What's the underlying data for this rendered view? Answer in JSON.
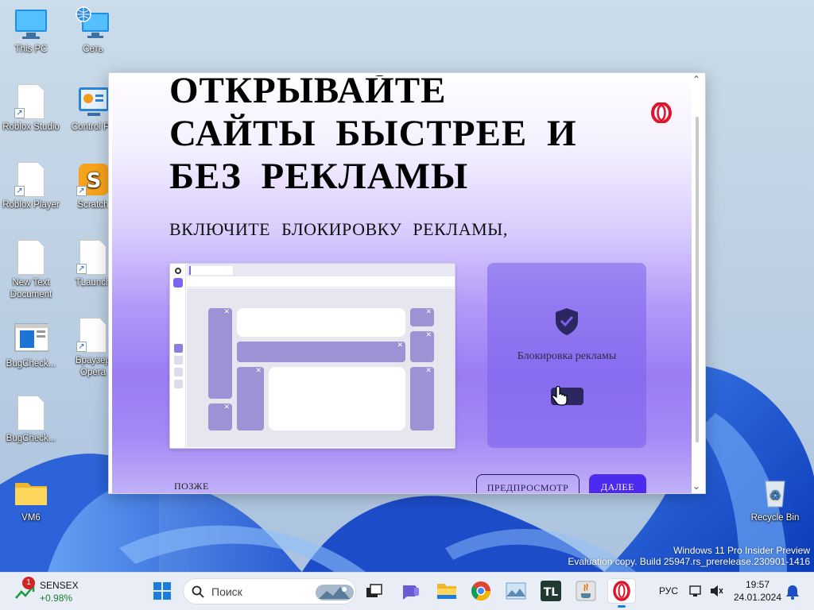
{
  "desktop": {
    "icons": [
      {
        "label": "This PC"
      },
      {
        "label": "Сеть"
      },
      {
        "label": "Roblox Studio"
      },
      {
        "label": "Control Pa"
      },
      {
        "label": "Roblox Player"
      },
      {
        "label": "Scratch"
      },
      {
        "label": "New Text Document"
      },
      {
        "label": "TLaunch"
      },
      {
        "label": "BugCheck..."
      },
      {
        "label": "Браузер Opera"
      },
      {
        "label": "BugCheck..."
      },
      {
        "label": "VM6"
      },
      {
        "label": "Recycle Bin"
      }
    ],
    "watermark": {
      "line1": "Windows 11 Pro Insider Preview",
      "line2": "Evaluation copy. Build 25947.rs_prerelease.230901-1416"
    }
  },
  "dialog": {
    "headline": [
      "ОТКРЫВАЙТЕ",
      "САЙТЫ БЫСТРЕЕ И",
      "БЕЗ РЕКЛАМЫ"
    ],
    "subtitle": "ВКЛЮЧИТЕ БЛОКИРОВКУ РЕКЛАМЫ,",
    "card_label": "Блокировка рекламы",
    "later_label": "ПОЗЖЕ",
    "preview_label": "ПРЕДПРОСМОТР",
    "next_label": "ДАЛЕЕ",
    "brand_color": "#e0142b",
    "accent_color": "#4d2af0"
  },
  "taskbar": {
    "widget": {
      "badge": "1",
      "name": "SENSEX",
      "change": "+0.98%"
    },
    "search_placeholder": "Поиск",
    "apps": [
      "windows-start-icon",
      "task-view-icon",
      "chat-icon",
      "file-explorer-icon",
      "chrome-icon",
      "photos-icon",
      "tlauncher-icon",
      "java-icon",
      "opera-icon"
    ],
    "language": "РУС",
    "time": "19:57",
    "date": "24.01.2024"
  }
}
